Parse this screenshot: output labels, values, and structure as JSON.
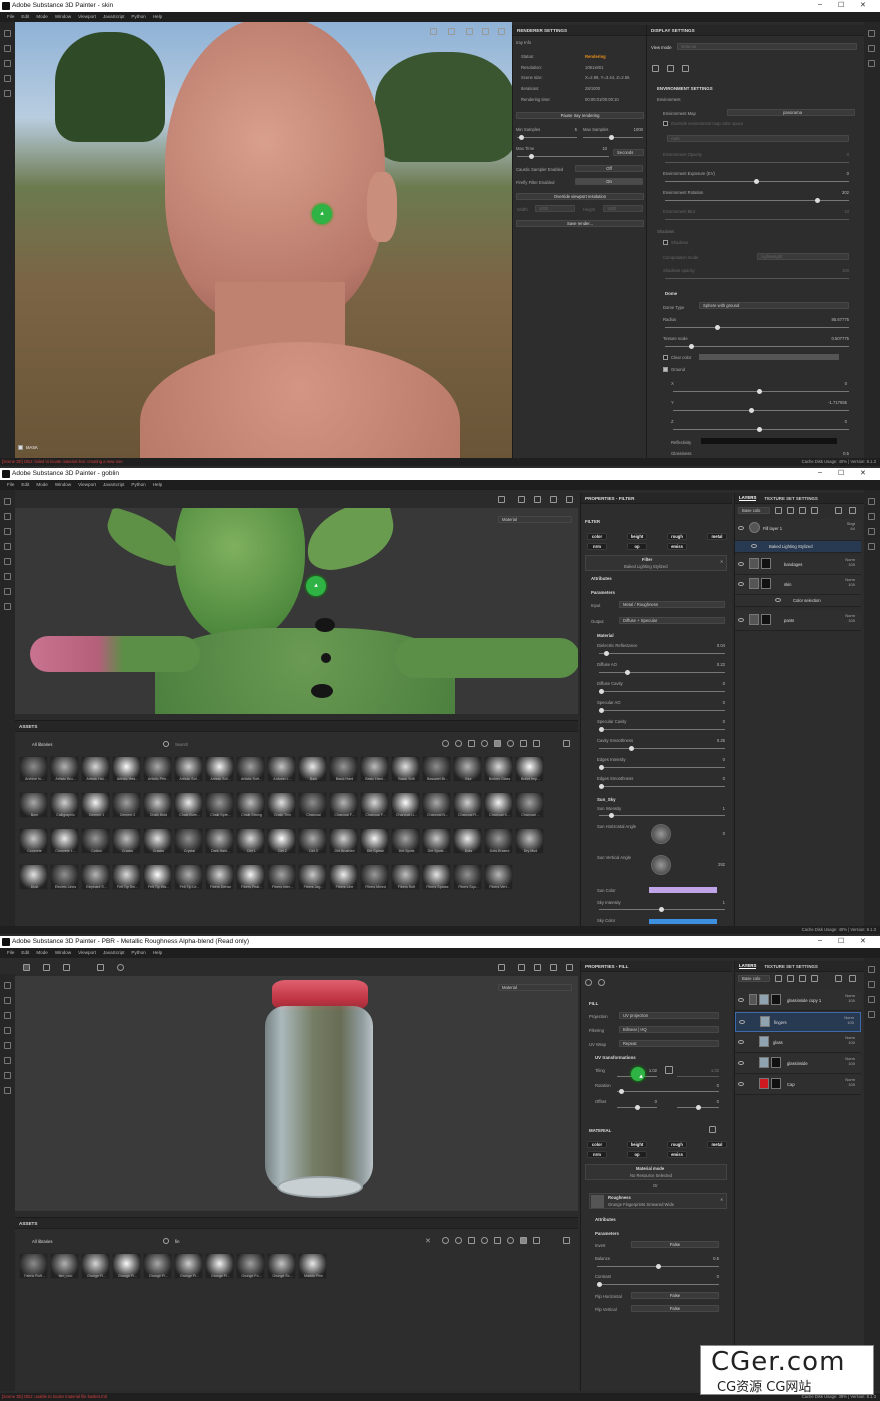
{
  "menu": [
    "File",
    "Edit",
    "Mode",
    "Window",
    "Viewport",
    "JavaScript",
    "Python",
    "Help"
  ],
  "window_controls": [
    "–",
    "☐",
    "✕"
  ],
  "icons": {
    "app": "substance-painter-logo",
    "eye": "eye-icon",
    "folder": "folder-icon",
    "trash": "trash-icon",
    "lock": "lock-icon",
    "search": "search-icon",
    "grid": "grid-icon",
    "cursor": "pointer-cursor"
  },
  "colors": {
    "accent_orange": "#e58e1a",
    "cursor_green": "#2fb344",
    "error_red": "#d04040",
    "sun_color": "#c0a4e8"
  },
  "win1": {
    "title": "Adobe Substance 3D Painter - skin",
    "mask_label": "MASK",
    "renderer": {
      "header": "RENDERER SETTINGS",
      "iray_info": "Iray Info",
      "rows": [
        {
          "label": "Status:",
          "value": "Rendering"
        },
        {
          "label": "Resolution:",
          "value": "1081x901"
        },
        {
          "label": "Scene size:",
          "value": "X=2.99, Y=3.44, Z=2.55"
        },
        {
          "label": "Iterations:",
          "value": "28/1000"
        },
        {
          "label": "Rendering time:",
          "value": "00:00:01/00:00:10"
        }
      ],
      "pause_btn": "Pause Iray rendering",
      "min_samples_label": "Min Samples",
      "min_samples_value": "5",
      "max_samples_label": "Max Samples",
      "max_samples_value": "1000",
      "max_time_label": "Max Time",
      "max_time_value": "10",
      "max_time_unit": "Seconds",
      "caustic_label": "Caustic Sampler Enabled",
      "caustic_value": "Off",
      "firefly_label": "Firefly Filter Enabled",
      "firefly_value": "On",
      "override_btn": "Override viewport resolution",
      "width_label": "Width",
      "width_value": "1030",
      "height_label": "Height",
      "height_value": "1200",
      "save_btn": "Save render..."
    },
    "display": {
      "header": "DISPLAY SETTINGS",
      "view_mode_label": "View mode",
      "view_mode_value": "Material",
      "env_header": "ENVIRONMENT SETTINGS",
      "environment": "Environment",
      "env_map_label": "Environment Map",
      "env_map_value": "panorama",
      "override_color": "Override environment map color space",
      "auto": "Auto",
      "env_opacity_label": "Environment Opacity",
      "env_opacity_value": "0",
      "env_exposure_label": "Environment Exposure (EV)",
      "env_exposure_value": "0",
      "env_rotation_label": "Environment Rotation",
      "env_rotation_value": "302",
      "env_blur_label": "Environment Blur",
      "env_blur_value": "10",
      "shadows": "Shadows",
      "shadows_check": "Shadows",
      "computation_label": "Computation mode",
      "computation_value": "Lightweight",
      "shadow_opacity_label": "Shadows opacity",
      "shadow_opacity_value": "100",
      "dome_header": "Dome",
      "dome_type_label": "Dome Type",
      "dome_type_value": "Sphere with ground",
      "radius_label": "Radius",
      "radius_value": "85.67775",
      "texture_scale_label": "Texture scale",
      "texture_scale_value": "0.507775",
      "clear_color": "Clear color",
      "ground": "Ground",
      "x_label": "X",
      "x_value": "0",
      "y_label": "Y",
      "y_value": "-1.717555",
      "z_label": "Z",
      "z_value": "0",
      "reflectivity": "Reflectivity",
      "glossiness_label": "Glossiness",
      "glossiness_value": "0.5"
    },
    "status_error": "[Scene 3D] OBJ: failed to locate material lexi: creating a new one",
    "status_info": "Cache Disk Usage:   40% | Version: 8.1.3"
  },
  "win2": {
    "title": "Adobe Substance 3D Painter - goblin",
    "viewport_mode": "Material",
    "props": {
      "header": "PROPERTIES - FILTER",
      "filter_label": "FILTER",
      "channels": [
        "color",
        "height",
        "rough",
        "metal",
        "nrm",
        "op",
        "emiss"
      ],
      "filter_btn": "Filter",
      "filter_name": "Baked Lighting Stylized",
      "attributes": "Attributes",
      "parameters": "Parameters",
      "input_label": "Input",
      "input_value": "Metal / Roughness",
      "output_label": "Output",
      "output_value": "Diffuse + Specular",
      "material_header": "Material",
      "sliders": [
        {
          "label": "Dielectric Reflectance",
          "value": "0.04"
        },
        {
          "label": "Diffuse AO",
          "value": "0.22"
        },
        {
          "label": "Diffuse Cavity",
          "value": "0"
        },
        {
          "label": "Specular AO",
          "value": "0"
        },
        {
          "label": "Specular Cavity",
          "value": "0"
        },
        {
          "label": "Cavity Smoothness",
          "value": "0.25"
        },
        {
          "label": "Edges Intensity",
          "value": "0"
        },
        {
          "label": "Edges Smoothness",
          "value": "0"
        }
      ],
      "sun_sky": "Sun_Sky",
      "sun_intensity_label": "Sun Intensity",
      "sun_intensity_value": "1",
      "sun_h_label": "Sun Horizontal Angle",
      "sun_h_value": "0",
      "sun_v_label": "Sun Vertical Angle",
      "sun_v_value": "292",
      "sun_color_label": "Sun Color",
      "sky_intensity_label": "Sky Intensity",
      "sky_intensity_value": "1",
      "sky_color_label": "Sky Color"
    },
    "layers": {
      "tab1": "LAYERS",
      "tab2": "TEXTURE SET SETTINGS",
      "channel": "Base colo",
      "items": [
        {
          "name": "Fill layer 1",
          "blend": "Sbgt",
          "opacity": "64"
        },
        {
          "name": "Baked Lighting Stylized",
          "blend": "",
          "opacity": ""
        },
        {
          "name": "bandages",
          "blend": "Norm",
          "opacity": "100"
        },
        {
          "name": "skin",
          "blend": "Norm",
          "opacity": "100"
        },
        {
          "name": "Color selection",
          "blend": "",
          "opacity": ""
        },
        {
          "name": "pants",
          "blend": "Norm",
          "opacity": "100"
        }
      ]
    },
    "assets": {
      "header": "ASSETS",
      "library": "All libraries",
      "search_placeholder": "Search",
      "items": [
        "Archive In...",
        "Artistic Bru...",
        "Artistic Hai...",
        "Artistic Hea...",
        "Artistic Prin...",
        "Artistic Sof...",
        "Artistic Sof...",
        "Artistic Soft...",
        "Autumn L...",
        "Bark",
        "Basic Hard",
        "Basic Hard...",
        "Basic Soft",
        "Basswet Br...",
        "Blur",
        "Broken Glass",
        "Bullet Imp...",
        "Burn",
        "Calligraphic",
        "Cement 1",
        "Cement 2",
        "Chalk Bold",
        "Chalk Bum...",
        "Chalk Spre...",
        "Chalk Strong",
        "Chalk Thin",
        "Charcoal",
        "Charcoal F...",
        "Charcoal F...",
        "Charcoal Li...",
        "Charcoal N...",
        "Charcoal R...",
        "Charcoal S...",
        "Charcoal ...",
        "Concrete",
        "Concrete L...",
        "Cotton",
        "Cracks",
        "Cracks",
        "Crystal",
        "Dark Hairl...",
        "Dirt 1",
        "Dirt 2",
        "Dirt 3",
        "Dirt Brushed",
        "Dirt Splash",
        "Dirt Spots",
        "Dirt Spots ...",
        "Dots",
        "Dots Erased",
        "Dry Mud",
        "Dust",
        "Electric Lines",
        "Elephant S...",
        "Felt Tip Sm...",
        "Felt Tip Wa...",
        "Felt Tip Le...",
        "Fibers Dense",
        "Fibers Feat...",
        "Fibers Inter...",
        "Fibers Jag...",
        "Fibers Line",
        "Fibers Mixed",
        "Fibers Soft",
        "Fibers Sparse",
        "Fibers Squ...",
        "Fibers Vert..."
      ]
    },
    "status_info": "Cache Disk Usage:   40% | Version: 8.1.3"
  },
  "win3": {
    "title": "Adobe Substance 3D Painter - PBR - Metallic Roughness Alpha-blend (Read only)",
    "viewport_mode": "Material",
    "props": {
      "header": "PROPERTIES - FILL",
      "fill_label": "FILL",
      "projection_label": "Projection",
      "projection_value": "UV projection",
      "filtering_label": "Filtering",
      "filtering_value": "Bilinear | HQ",
      "uvwrap_label": "UV Wrap",
      "uvwrap_value": "Repeat",
      "uv_transform": "UV transformations",
      "tiling_label": "Tiling",
      "tiling_value": "1.02",
      "tiling_value2": "1.02",
      "rotation_label": "Rotation",
      "rotation_value": "0",
      "offset_label": "Offset",
      "offset_value": "0",
      "offset_value2": "0",
      "material_label": "MATERIAL",
      "channels": [
        "color",
        "height",
        "rough",
        "metal",
        "nrm",
        "op",
        "emiss"
      ],
      "material_mode": "Material mode",
      "no_resource": "No Resource Selected",
      "or": "Or",
      "rough_title": "Roughness",
      "rough_name": "Grunge Fingerprints Smeared Wide",
      "attributes": "Attributes",
      "parameters": "Parameters",
      "invert_label": "Invert",
      "invert_value": "False",
      "balance_label": "Balance",
      "balance_value": "0.5",
      "contrast_label": "Contrast",
      "contrast_value": "0",
      "fliph_label": "Flip Horizontal",
      "fliph_value": "False",
      "flipv_label": "Flip Vertical",
      "flipv_value": "False"
    },
    "layers": {
      "tab1": "LAYERS",
      "tab2": "TEXTURE SET SETTINGS",
      "channel": "Base colo",
      "items": [
        {
          "name": "glassinside copy 1",
          "blend": "Norm",
          "opacity": "100"
        },
        {
          "name": "fingers",
          "blend": "Norm",
          "opacity": "100"
        },
        {
          "name": "glass",
          "blend": "Norm",
          "opacity": "100"
        },
        {
          "name": "glassinside",
          "blend": "Norm",
          "opacity": "100"
        },
        {
          "name": "Cap",
          "blend": "Norm",
          "opacity": "100"
        }
      ]
    },
    "assets": {
      "header": "ASSETS",
      "library": "All libraries",
      "search_value": "fin",
      "items": [
        "Fabric Ruff...",
        "fkm_noo",
        "Grunge Fi...",
        "Grunge Fi...",
        "Grunge Fi...",
        "Grunge Fi...",
        "Grunge Fi...",
        "Grunge Fo...",
        "Grunge Sc...",
        "Marble Fine"
      ]
    },
    "status_error": "[Scene 3D] OBJ: unable to locate material file basket.mtl",
    "status_info": "Cache Disk Usage:   38% | Version: 8.1.3"
  },
  "watermark": {
    "line1": "CGer.com",
    "line2": "CG资源  CG网站"
  }
}
